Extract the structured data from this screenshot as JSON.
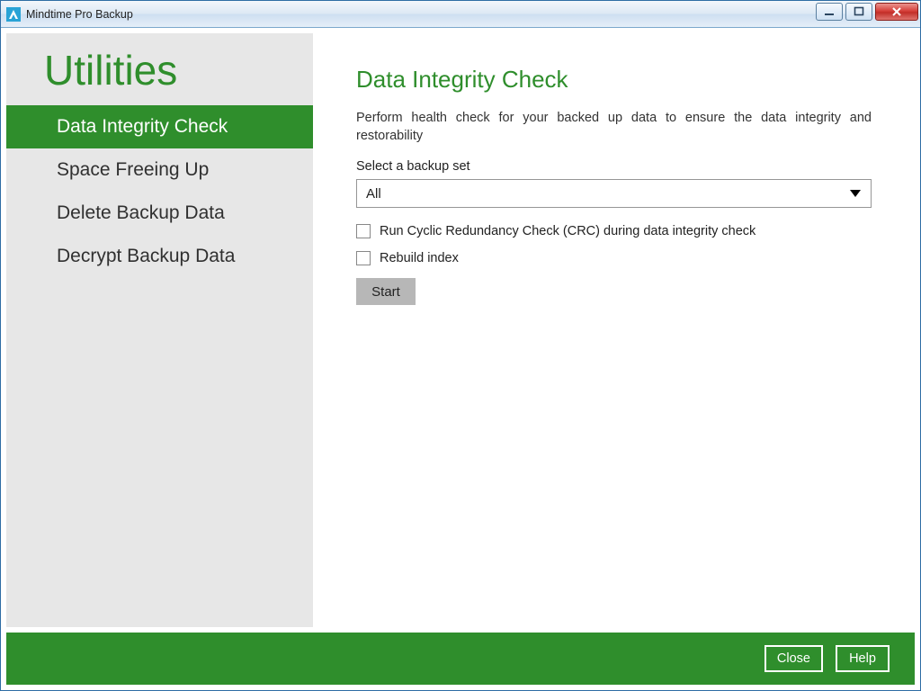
{
  "window": {
    "title": "Mindtime Pro Backup"
  },
  "sidebar": {
    "title": "Utilities",
    "items": [
      {
        "label": "Data Integrity Check",
        "active": true
      },
      {
        "label": "Space Freeing Up",
        "active": false
      },
      {
        "label": "Delete Backup Data",
        "active": false
      },
      {
        "label": "Decrypt Backup Data",
        "active": false
      }
    ]
  },
  "main": {
    "title": "Data Integrity Check",
    "description": "Perform health check for your backed up data to ensure the data integrity and restorability",
    "select_label": "Select a backup set",
    "select_value": "All",
    "crc_label": "Run Cyclic Redundancy Check (CRC) during data integrity check",
    "rebuild_label": "Rebuild index",
    "start_label": "Start"
  },
  "footer": {
    "close": "Close",
    "help": "Help"
  },
  "colors": {
    "accent_green": "#2f8e2c",
    "sidebar_bg": "#e7e7e7"
  }
}
